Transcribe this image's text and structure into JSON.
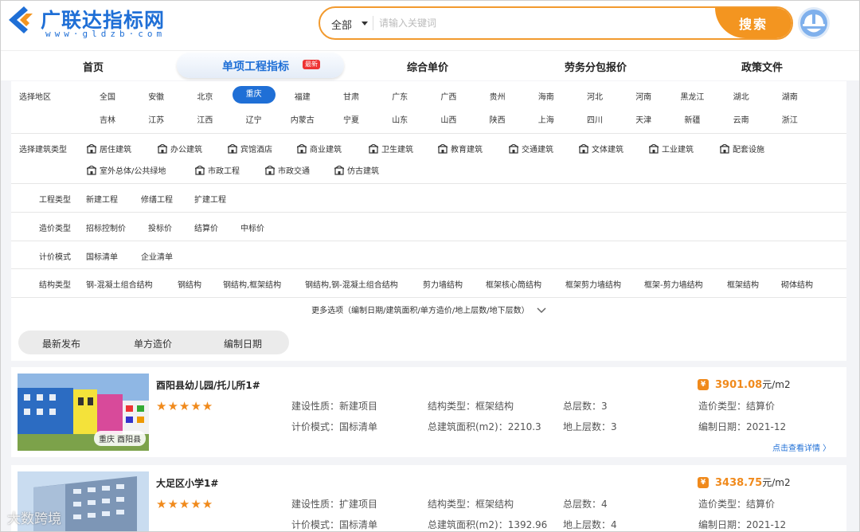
{
  "brand": {
    "title": "广联达指标网",
    "url": "www·gldzb·com"
  },
  "search": {
    "scope": "全部",
    "placeholder": "请输入关键词",
    "button": "搜索"
  },
  "nav": {
    "items": [
      "首页",
      "综合单价",
      "劳务分包报价",
      "政策文件"
    ],
    "active": "单项工程指标",
    "badge": "最新"
  },
  "filters": {
    "region_label": "选择地区",
    "regions_row1": [
      "全国",
      "安徽",
      "北京",
      "重庆",
      "福建",
      "甘肃",
      "广东",
      "广西",
      "贵州",
      "海南",
      "河北",
      "河南",
      "黑龙江",
      "湖北",
      "湖南"
    ],
    "regions_row2": [
      "吉林",
      "江苏",
      "江西",
      "辽宁",
      "内蒙古",
      "宁夏",
      "山东",
      "山西",
      "陕西",
      "上海",
      "四川",
      "天津",
      "新疆",
      "云南",
      "浙江"
    ],
    "active_region": "重庆",
    "building_label": "选择建筑类型",
    "building_types_row1": [
      "居住建筑",
      "办公建筑",
      "宾馆酒店",
      "商业建筑",
      "卫生建筑",
      "教育建筑",
      "交通建筑",
      "文体建筑",
      "工业建筑",
      "配套设施"
    ],
    "building_types_row2": [
      "室外总体/公共绿地",
      "市政工程",
      "市政交通",
      "仿古建筑"
    ],
    "project_label": "工程类型",
    "project_types": [
      "新建工程",
      "修缮工程",
      "扩建工程"
    ],
    "cost_label": "造价类型",
    "cost_types": [
      "招标控制价",
      "投标价",
      "结算价",
      "中标价"
    ],
    "pricing_label": "计价模式",
    "pricing_modes": [
      "国标清单",
      "企业清单"
    ],
    "structure_label": "结构类型",
    "structure_types": [
      "钢-混凝土组合结构",
      "钢结构",
      "钢结构,框架结构",
      "钢结构,钢-混凝土组合结构",
      "剪力墙结构",
      "框架核心筒结构",
      "框架剪力墙结构",
      "框架-剪力墙结构",
      "框架结构",
      "砌体结构"
    ],
    "more": "更多选项（编制日期/建筑面积/单方造价/地上层数/地下层数）"
  },
  "sort": {
    "items": [
      "最新发布",
      "单方造价",
      "编制日期"
    ]
  },
  "cards": [
    {
      "title": "酉阳县幼儿园/托儿所1#",
      "location": "重庆 酉阳县",
      "stars": "★★★★★",
      "nature": "建设性质：新建项目",
      "pricing": "计价模式：国标清单",
      "structure": "结构类型：框架结构",
      "area": "总建筑面积(m2)：2210.3",
      "floors": "总层数：3",
      "above": "地上层数：3",
      "price_value": "3901.08",
      "price_unit": "元/m2",
      "cost_type": "造价类型：结算价",
      "date": "编制日期：2021-12",
      "link": "点击查看详情 〉"
    },
    {
      "title": "大足区小学1#",
      "stars": "★★★★★",
      "nature": "建设性质：扩建项目",
      "pricing": "计价模式：国标清单",
      "structure": "结构类型：框架结构",
      "area": "总建筑面积(m2)：1392.96",
      "floors": "总层数：4",
      "above": "地上层数：4",
      "price_value": "3438.75",
      "price_unit": "元/m2",
      "cost_type": "造价类型：结算价",
      "date": "编制日期：2021-12"
    }
  ],
  "watermark": "大数跨境",
  "colors": {
    "brand_blue": "#1f6fd6",
    "accent_orange": "#f39520",
    "star_orange": "#f08a1c"
  }
}
